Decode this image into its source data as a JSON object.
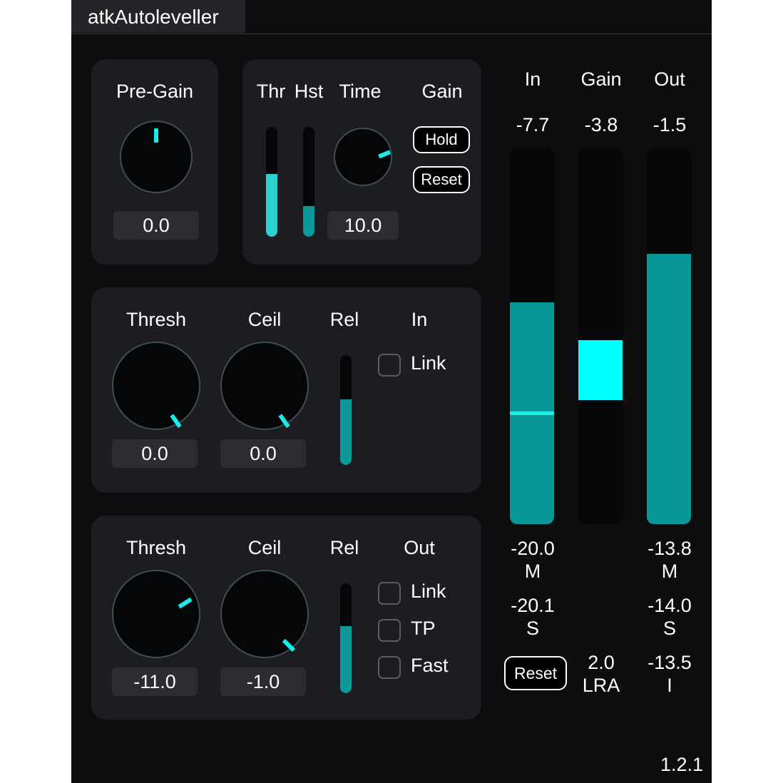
{
  "app": {
    "title": "atkAutoleveller",
    "version": "1.2.1"
  },
  "pregain": {
    "label": "Pre-Gain",
    "value": "0.0",
    "knob_angle_deg": 0
  },
  "leveller": {
    "thr_label": "Thr",
    "hst_label": "Hst",
    "time_label": "Time",
    "gain_label": "Gain",
    "thr_level": 0.57,
    "hst_level": 0.28,
    "time_value": "10.0",
    "time_angle_deg": 68,
    "hold_label": "Hold",
    "reset_label": "Reset"
  },
  "in_limiter": {
    "title": "In",
    "thresh_label": "Thresh",
    "thresh_value": "0.0",
    "thresh_angle_deg": 145,
    "ceil_label": "Ceil",
    "ceil_value": "0.0",
    "ceil_angle_deg": 145,
    "rel_label": "Rel",
    "rel_level": 0.6,
    "link_label": "Link",
    "link_checked": false
  },
  "out_limiter": {
    "title": "Out",
    "thresh_label": "Thresh",
    "thresh_value": "-11.0",
    "thresh_angle_deg": 58,
    "ceil_label": "Ceil",
    "ceil_value": "-1.0",
    "ceil_angle_deg": 135,
    "rel_label": "Rel",
    "rel_level": 0.61,
    "link_label": "Link",
    "link_checked": false,
    "tp_label": "TP",
    "tp_checked": false,
    "fast_label": "Fast",
    "fast_checked": false
  },
  "meters": {
    "in": {
      "label": "In",
      "peak": "-7.7",
      "level": 0.59,
      "marker_level": 0.29
    },
    "gain": {
      "label": "Gain",
      "peak": "-3.8",
      "block_top": 0.49,
      "block_bottom": 0.33
    },
    "out": {
      "label": "Out",
      "peak": "-1.5",
      "level": 0.72
    },
    "in_m_value": "-20.0",
    "in_m_label": "M",
    "in_s_value": "-20.1",
    "in_s_label": "S",
    "out_m_value": "-13.8",
    "out_m_label": "M",
    "out_s_value": "-14.0",
    "out_s_label": "S",
    "reset_label": "Reset",
    "lra_value": "2.0",
    "lra_label": "LRA",
    "out_i_value": "-13.5",
    "out_i_label": "I"
  },
  "colors": {
    "accent": "#19eaea",
    "meter_fill": "#079797",
    "background": "#0c0d0f",
    "panel": "#1c1d20"
  }
}
